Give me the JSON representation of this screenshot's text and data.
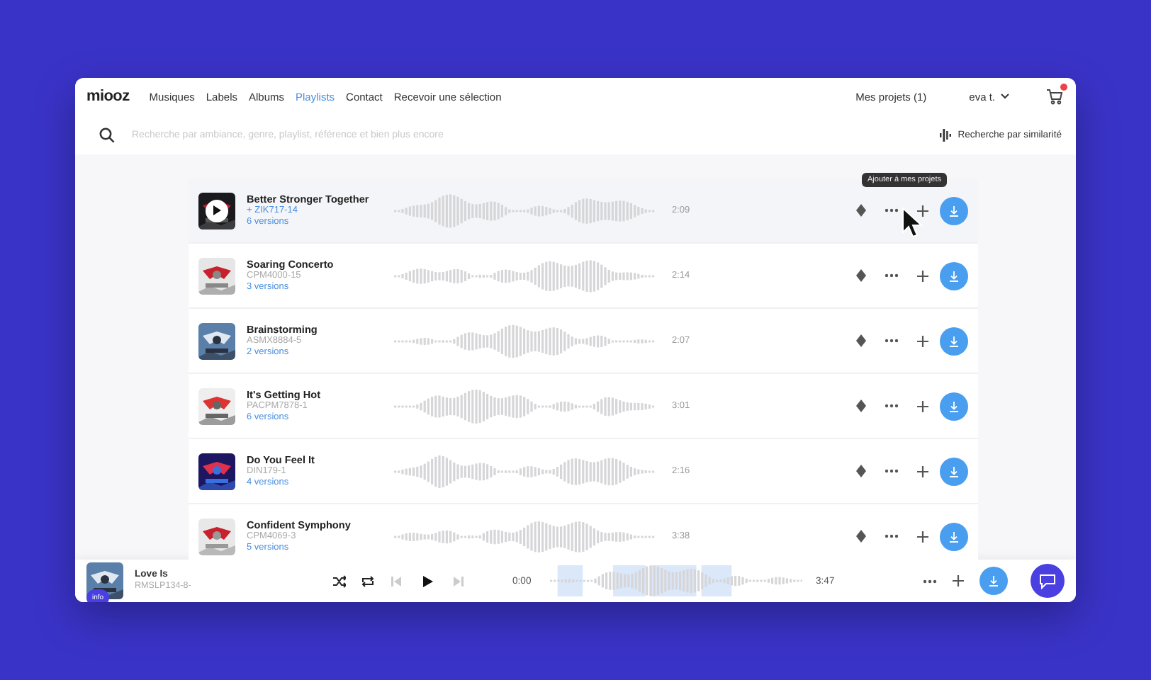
{
  "header": {
    "logo": "miooz",
    "nav": [
      {
        "label": "Musiques",
        "selected": false
      },
      {
        "label": "Labels",
        "selected": false
      },
      {
        "label": "Albums",
        "selected": false
      },
      {
        "label": "Playlists",
        "selected": true
      },
      {
        "label": "Contact",
        "selected": false
      },
      {
        "label": "Recevoir une sélection",
        "selected": false
      }
    ],
    "projects": "Mes projets (1)",
    "user": "eva t.",
    "cart_badge": true
  },
  "search": {
    "placeholder": "Recherche par ambiance, genre, playlist, référence et bien plus encore",
    "similarity": "Recherche par similarité"
  },
  "tracks": [
    {
      "title": "Better Stronger Together",
      "code": "+ ZIK717-14",
      "versions": "6 versions",
      "duration": "2:09",
      "selected": true,
      "tooltip": "Ajouter à mes projets"
    },
    {
      "title": "Soaring Concerto",
      "code": "CPM4000-15",
      "versions": "3 versions",
      "duration": "2:14",
      "selected": false
    },
    {
      "title": "Brainstorming",
      "code": "ASMX8884-5",
      "versions": "2 versions",
      "duration": "2:07",
      "selected": false
    },
    {
      "title": "It's Getting Hot",
      "code": "PACPM7878-1",
      "versions": "6 versions",
      "duration": "3:01",
      "selected": false
    },
    {
      "title": "Do You Feel It",
      "code": "DIN179-1",
      "versions": "4 versions",
      "duration": "2:16",
      "selected": false
    },
    {
      "title": "Confident Symphony",
      "code": "CPM4069-3",
      "versions": "5 versions",
      "duration": "3:38",
      "selected": false
    }
  ],
  "player": {
    "title": "Love Is",
    "code": "RMSLP134-8-",
    "badge": "info",
    "elapsed": "0:00",
    "total": "3:47"
  }
}
